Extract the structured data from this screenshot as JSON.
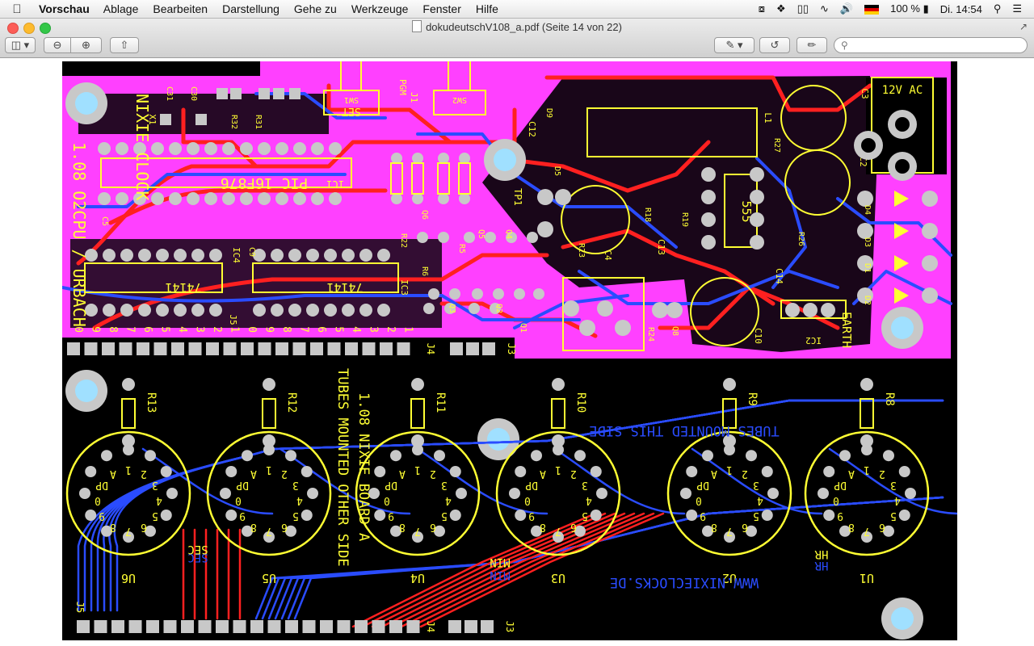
{
  "menubar": {
    "apple": "",
    "app_name": "Vorschau",
    "items": [
      "Ablage",
      "Bearbeiten",
      "Darstellung",
      "Gehe zu",
      "Werkzeuge",
      "Fenster",
      "Hilfe"
    ],
    "battery_text": "100 %",
    "clock": "Di. 14:54"
  },
  "window": {
    "title": "dokudeutschV108_a.pdf (Seite 14 von 22)"
  },
  "colors": {
    "board": "#000000",
    "silkscreen": "#ffff33",
    "copper_top": "#ff2020",
    "copper_bottom": "#2a4cff",
    "pad": "#c8c8c8",
    "drill": "#a0e0ff",
    "top_plane": "#ff40ff"
  },
  "pcb": {
    "upper_labels": {
      "clock_name": "NIXIE CLOCK",
      "version_line": "1.08 O2CPU / URBACH",
      "mcu": "PIC 16F876",
      "timer": "555",
      "ic_a": "74141",
      "ic_b": "74141",
      "power": "12V AC",
      "earth": "EARTH",
      "set": "SET",
      "sw1": "SW1",
      "sw2": "SW2",
      "pgm": "PGM",
      "tp1": "TP1",
      "ic1": "IC1",
      "ic2": "IC2",
      "ic3": "IC3",
      "ic4": "IC4",
      "j1": "J1",
      "j3": "J3",
      "j4": "J4",
      "j5": "J5",
      "c1": "C1",
      "c2": "C2",
      "c3": "C3",
      "c4": "C4",
      "c5": "C5",
      "c9": "C9",
      "c10": "C10",
      "c12": "C12",
      "c13": "C13",
      "c14": "C14",
      "c30": "C30",
      "c31": "C31",
      "d1": "D1",
      "d2": "D2",
      "d3": "D3",
      "d4": "D4",
      "d5": "D5",
      "d9": "D9",
      "r18": "R18",
      "r19": "R19",
      "r22": "R22",
      "r23": "R23",
      "r24": "R24",
      "r26": "R26",
      "r27": "R27",
      "r31": "R31",
      "r32": "R32",
      "q1": "Q1",
      "q2": "Q2",
      "q3": "Q3",
      "q4": "Q4",
      "q5": "Q5",
      "q6": "Q6",
      "q8": "Q8",
      "r5": "R5",
      "r6": "R6",
      "x1": "X1",
      "l1": "L1"
    },
    "lower_labels": {
      "board_title": "1.08 NIXIE BOARD A",
      "mount_note": "TUBES MOUNTED OTHER SIDE",
      "mount_note_mirror": "TUBES MOUNTED THIS SIDE",
      "website": "WWW.NIXIECLOCKS.DE",
      "sec": "SEC",
      "min": "MIN",
      "hr": "HR",
      "j3": "J3",
      "j4": "J4",
      "j5": "J5"
    },
    "tubes": [
      {
        "name": "U6",
        "resistor": "R13"
      },
      {
        "name": "U5",
        "resistor": "R12"
      },
      {
        "name": "U4",
        "resistor": "R11"
      },
      {
        "name": "U3",
        "resistor": "R10"
      },
      {
        "name": "U2",
        "resistor": "R9"
      },
      {
        "name": "U1",
        "resistor": "R8"
      }
    ],
    "pin_labels": [
      "1",
      "2",
      "3",
      "4",
      "5",
      "6",
      "7",
      "8",
      "9",
      "0",
      "DP",
      "A"
    ],
    "header_digits": [
      "0",
      "9",
      "8",
      "7",
      "6",
      "5",
      "4",
      "3",
      "2",
      "1",
      "0",
      "9",
      "8",
      "7",
      "6",
      "5",
      "4",
      "3",
      "2",
      "1"
    ]
  }
}
